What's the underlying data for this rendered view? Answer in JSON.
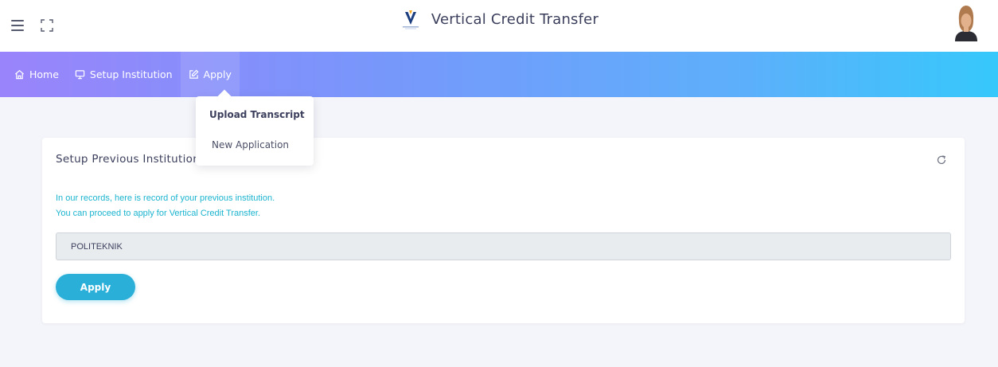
{
  "header": {
    "title": "Vertical Credit Transfer",
    "menu_icon": "hamburger-icon",
    "fullscreen_icon": "fullscreen-icon",
    "avatar_icon": "user-avatar"
  },
  "nav": {
    "items": [
      {
        "label": "Home",
        "icon": "home-icon"
      },
      {
        "label": "Setup Institution",
        "icon": "monitor-icon"
      },
      {
        "label": "Apply",
        "icon": "edit-icon"
      }
    ],
    "dropdown": [
      {
        "label": "Upload Transcript"
      },
      {
        "label": "New Application"
      }
    ]
  },
  "card": {
    "title": "Setup Previous Institution",
    "message_line1": "In our records, here is record of your previous institution.",
    "message_line2": "You can proceed to apply for Vertical Credit Transfer.",
    "institution_value": "POLITEKNIK",
    "apply_label": "Apply"
  },
  "colors": {
    "nav_gradient_start": "#9a84fb",
    "nav_gradient_end": "#36c8fb",
    "message_text": "#1ab4cf",
    "apply_button": "#2ab0d8"
  }
}
